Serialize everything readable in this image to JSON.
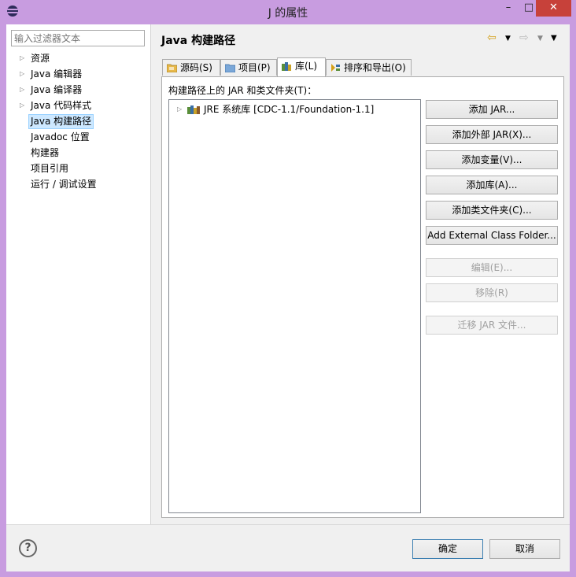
{
  "window": {
    "title": "J 的属性",
    "minimize": "–",
    "maximize": "□",
    "close": "✕"
  },
  "sidebar": {
    "filter_placeholder": "输入过滤器文本",
    "items": [
      {
        "label": "资源",
        "has_children": true
      },
      {
        "label": "Java 编辑器",
        "has_children": true
      },
      {
        "label": "Java 编译器",
        "has_children": true
      },
      {
        "label": "Java 代码样式",
        "has_children": true
      },
      {
        "label": "Java 构建路径",
        "has_children": false,
        "selected": true
      },
      {
        "label": "Javadoc 位置",
        "has_children": false
      },
      {
        "label": "构建器",
        "has_children": false
      },
      {
        "label": "项目引用",
        "has_children": false
      },
      {
        "label": "运行 / 调试设置",
        "has_children": false
      }
    ]
  },
  "main": {
    "title": "Java 构建路径",
    "nav": {
      "back_icon": "back-arrow-icon",
      "forward_icon": "forward-arrow-icon",
      "menu_icon": "view-menu-icon"
    },
    "tabs": [
      {
        "label": "源码(S)",
        "icon": "source-folder-icon"
      },
      {
        "label": "项目(P)",
        "icon": "project-folder-icon"
      },
      {
        "label": "库(L)",
        "icon": "library-icon",
        "active": true
      },
      {
        "label": "排序和导出(O)",
        "icon": "order-export-icon"
      }
    ],
    "section_label": "构建路径上的 JAR 和类文件夹(T)：",
    "libraries": [
      {
        "label": "JRE 系统库 [CDC-1.1/Foundation-1.1]",
        "icon": "jre-library-icon"
      }
    ],
    "buttons": [
      {
        "label": "添加 JAR...",
        "enabled": true
      },
      {
        "label": "添加外部 JAR(X)...",
        "enabled": true
      },
      {
        "label": "添加变量(V)...",
        "enabled": true
      },
      {
        "label": "添加库(A)...",
        "enabled": true
      },
      {
        "label": "添加类文件夹(C)...",
        "enabled": true
      },
      {
        "label": "Add External Class Folder...",
        "enabled": true
      },
      {
        "label": "编辑(E)...",
        "enabled": false
      },
      {
        "label": "移除(R)",
        "enabled": false
      },
      {
        "label": "迁移 JAR 文件...",
        "enabled": false
      }
    ]
  },
  "footer": {
    "help": "?",
    "ok": "确定",
    "cancel": "取消"
  },
  "colors": {
    "window_frame": "#c89ce0",
    "close_button": "#c7413a",
    "selection": "#cde8ff"
  }
}
